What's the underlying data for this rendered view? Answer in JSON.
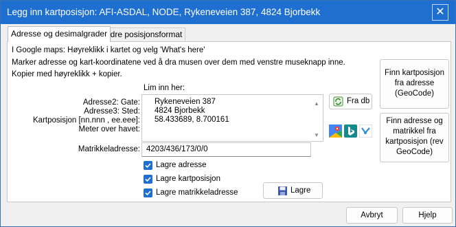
{
  "window": {
    "title": "Legg inn kartposisjon: AFI-ASDAL, NODE, Rykeneveien 387, 4824 Bjorbekk",
    "close_glyph": "✕"
  },
  "tabs": [
    {
      "label": "Adresse og desimalgrader",
      "active": true
    },
    {
      "label": "Andre posisjonsformat",
      "active": false
    }
  ],
  "instructions": [
    "I Google maps: Høyreklikk i kartet og velg 'What's here'",
    "Marker adresse og kart-koordinatene ved å dra musen over dem med venstre museknapp inne.",
    "Kopier med høyreklikk + kopier."
  ],
  "input_heading": "Lim inn her:",
  "labels": {
    "adresse2": "Adresse2: Gate:",
    "adresse3": "Adresse3: Sted:",
    "kartposisjon": "Kartposisjon [nn.nnn , ee.eee]:",
    "meter": "Meter over havet:",
    "matrikkel": "Matrikkeladresse:"
  },
  "paste_area": {
    "lines": [
      "Rykeneveien 387",
      "4824 Bjorbekk",
      "58.433689,  8.700161"
    ]
  },
  "matrikkel_value": "4203/436/173/0/0",
  "checkboxes": [
    {
      "label": "Lagre adresse",
      "checked": true
    },
    {
      "label": "Lagre kartposisjon",
      "checked": true
    },
    {
      "label": "Lagre matrikkeladresse",
      "checked": true
    }
  ],
  "buttons": {
    "fra_db": "Fra db",
    "lagre": "Lagre",
    "geocode": "Finn kartposisjon fra adresse (GeoCode)",
    "rev_geocode": "Finn adresse og matrikkel fra kartposisjon (rev GeoCode)",
    "avbryt": "Avbryt",
    "hjelp": "Hjelp"
  },
  "map_icons": [
    "google-maps-icon",
    "bing-icon",
    "map-tool-icon"
  ],
  "colors": {
    "accent": "#1f6fd1",
    "title_text": "#ffffff"
  }
}
